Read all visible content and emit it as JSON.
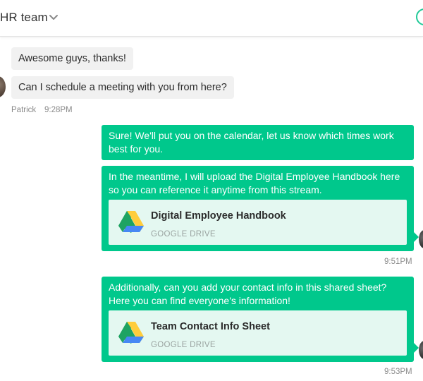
{
  "header": {
    "title": "HR team"
  },
  "incoming": {
    "messages": [
      {
        "text": "Awesome guys, thanks!"
      },
      {
        "text": "Can I schedule a meeting with you from here?"
      }
    ],
    "sender": "Patrick",
    "time": "9:28PM"
  },
  "outgoing": [
    {
      "text": "Sure! We'll put you on the calendar, let us know which times work best for you."
    },
    {
      "text": "In the meantime, I will upload the Digital Employee Handbook here so you can reference it anytime from this stream.",
      "attachment": {
        "name": "Digital Employee Handbook",
        "source": "GOOGLE DRIVE"
      },
      "time": "9:51PM"
    },
    {
      "text": "Additionally, can you add your contact info in this shared sheet? Here you can find everyone's information!",
      "attachment": {
        "name": "Team Contact Info Sheet",
        "source": "GOOGLE DRIVE"
      },
      "time": "9:53PM"
    }
  ],
  "colors": {
    "accent": "#00c88c",
    "attachment_bg": "#e4f8f1",
    "incoming_bg": "#f1f1f1"
  },
  "icons": {
    "header_dropdown": "chevron-down-icon",
    "attachment": "google-drive-icon"
  }
}
